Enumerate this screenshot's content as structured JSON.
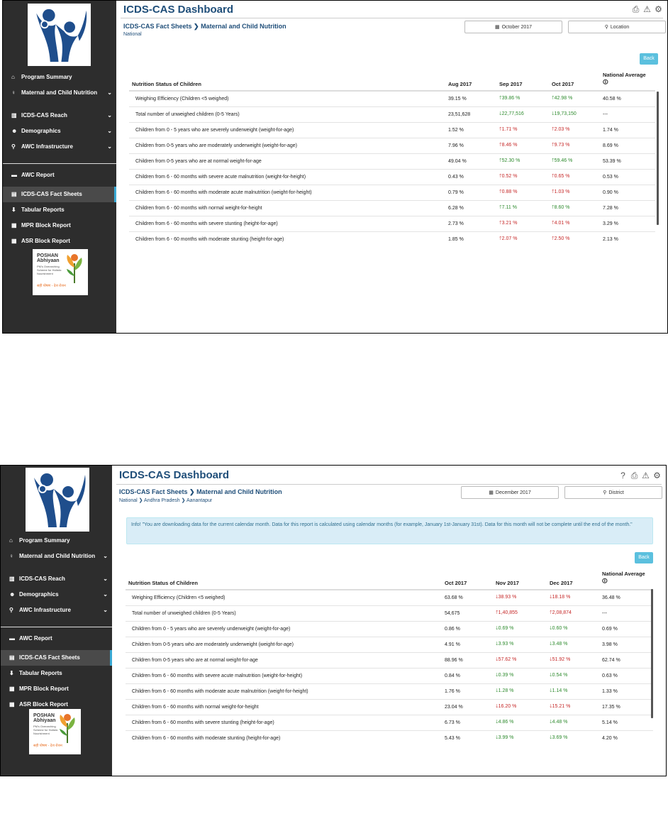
{
  "shots": [
    {
      "app_title": "ICDS-CAS Dashboard",
      "breadcrumb": "ICDS-CAS Fact Sheets ❯ Maternal and Child Nutrition",
      "location_path": "National",
      "month_picker": "October 2017",
      "location_picker": "Location",
      "back_label": "Back",
      "info_text": "",
      "top_icons": [
        "print-icon",
        "warning-icon",
        "gear-icon"
      ],
      "sidebar": {
        "group1": [
          {
            "icon": "home-icon",
            "label": "Program Summary",
            "chevron": false
          },
          {
            "icon": "maternal-icon",
            "label": "Maternal and Child Nutrition",
            "chevron": true
          },
          {
            "icon": "bar-chart-icon",
            "label": "ICDS-CAS Reach",
            "chevron": true
          },
          {
            "icon": "users-icon",
            "label": "Demographics",
            "chevron": true
          },
          {
            "icon": "map-marker-icon",
            "label": "AWC Infrastructure",
            "chevron": true
          }
        ],
        "group2": [
          {
            "icon": "report-icon",
            "label": "AWC Report",
            "active": false
          },
          {
            "icon": "file-icon",
            "label": "ICDS-CAS Fact Sheets",
            "active": true
          },
          {
            "icon": "download-icon",
            "label": "Tabular Reports",
            "active": false
          },
          {
            "icon": "grid-icon",
            "label": "MPR Block Report",
            "active": false
          },
          {
            "icon": "grid-icon",
            "label": "ASR Block Report",
            "active": false
          }
        ]
      },
      "poshan": {
        "title": "POSHAN Abhiyaan",
        "subtitle": "PM's Overarching Scheme for Holistic Nourishment",
        "hindi": "सही पोषण - देश रोशन"
      },
      "table": {
        "headers": [
          "Nutrition Status of Children",
          "Aug 2017",
          "Sep 2017",
          "Oct 2017",
          "National Average"
        ],
        "rows": [
          {
            "label": "Weighing Efficiency (Children <5 weighed)",
            "m1": "39.15 %",
            "m2": "39.86 %",
            "m2dir": "up-green",
            "m3": "42.98 %",
            "m3dir": "up-green",
            "avg": "40.58 %"
          },
          {
            "label": "Total number of unweighed children (0-5 Years)",
            "m1": "23,51,628",
            "m2": "22,77,516",
            "m2dir": "down-green",
            "m3": "19,73,150",
            "m3dir": "down-green",
            "avg": "---"
          },
          {
            "label": "Children from 0 - 5 years who are severely underweight (weight-for-age)",
            "m1": "1.52 %",
            "m2": "1.71 %",
            "m2dir": "up-red",
            "m3": "2.03 %",
            "m3dir": "up-red",
            "avg": "1.74 %"
          },
          {
            "label": "Children from 0-5 years who are moderately underweight (weight-for-age)",
            "m1": "7.96 %",
            "m2": "8.46 %",
            "m2dir": "up-red",
            "m3": "9.73 %",
            "m3dir": "up-red",
            "avg": "8.69 %"
          },
          {
            "label": "Children from 0-5 years who are at normal weight-for-age",
            "m1": "49.04 %",
            "m2": "52.30 %",
            "m2dir": "up-green",
            "m3": "59.46 %",
            "m3dir": "up-green",
            "avg": "53.39 %"
          },
          {
            "label": "Children from 6 - 60 months with severe acute malnutrition (weight-for-height)",
            "m1": "0.43 %",
            "m2": "0.52 %",
            "m2dir": "up-red",
            "m3": "0.65 %",
            "m3dir": "up-red",
            "avg": "0.53 %"
          },
          {
            "label": "Children from 6 - 60 months with moderate acute malnutrition (weight-for-height)",
            "m1": "0.79 %",
            "m2": "0.88 %",
            "m2dir": "up-red",
            "m3": "1.03 %",
            "m3dir": "up-red",
            "avg": "0.90 %"
          },
          {
            "label": "Children from 6 - 60 months with normal weight-for-height",
            "m1": "6.28 %",
            "m2": "7.11 %",
            "m2dir": "up-green",
            "m3": "8.60 %",
            "m3dir": "up-green",
            "avg": "7.28 %"
          },
          {
            "label": "Children from 6 - 60 months with severe stunting (height-for-age)",
            "m1": "2.73 %",
            "m2": "3.21 %",
            "m2dir": "up-red",
            "m3": "4.01 %",
            "m3dir": "up-red",
            "avg": "3.29 %"
          },
          {
            "label": "Children from 6 - 60 months with moderate stunting (height-for-age)",
            "m1": "1.85 %",
            "m2": "2.07 %",
            "m2dir": "up-red",
            "m3": "2.50 %",
            "m3dir": "up-red",
            "avg": "2.13 %"
          }
        ]
      }
    },
    {
      "app_title": "ICDS-CAS Dashboard",
      "breadcrumb": "ICDS-CAS Fact Sheets ❯ Maternal and Child Nutrition",
      "location_path": "National ❯ Andhra Pradesh ❯ Aanantapur",
      "month_picker": "December 2017",
      "location_picker": "District",
      "back_label": "Back",
      "info_text": "Info! \"You are downloading data for the current calendar month. Data for this report is calculated using calendar months (for example, January 1st-January 31st). Data for this month will not be complete until the end of the month.\"",
      "top_icons": [
        "help-icon",
        "print-icon",
        "warning-icon",
        "gear-icon"
      ],
      "sidebar": {
        "group1": [
          {
            "icon": "home-icon",
            "label": "Program Summary",
            "chevron": false
          },
          {
            "icon": "maternal-icon",
            "label": "Maternal and Child Nutrition",
            "chevron": true
          },
          {
            "icon": "bar-chart-icon",
            "label": "ICDS-CAS Reach",
            "chevron": true
          },
          {
            "icon": "users-icon",
            "label": "Demographics",
            "chevron": true
          },
          {
            "icon": "map-marker-icon",
            "label": "AWC Infrastructure",
            "chevron": true
          }
        ],
        "group2": [
          {
            "icon": "report-icon",
            "label": "AWC Report",
            "active": false
          },
          {
            "icon": "file-icon",
            "label": "ICDS-CAS Fact Sheets",
            "active": true
          },
          {
            "icon": "download-icon",
            "label": "Tabular Reports",
            "active": false
          },
          {
            "icon": "grid-icon",
            "label": "MPR Block Report",
            "active": false
          },
          {
            "icon": "grid-icon",
            "label": "ASR Block Report",
            "active": false
          }
        ]
      },
      "poshan": {
        "title": "POSHAN Abhiyaan",
        "subtitle": "PM's Overarching Scheme for Holistic Nourishment",
        "hindi": "सही पोषण - देश रोशन"
      },
      "table": {
        "headers": [
          "Nutrition Status of Children",
          "Oct 2017",
          "Nov 2017",
          "Dec 2017",
          "National Average"
        ],
        "rows": [
          {
            "label": "Weighing Efficiency (Children <5 weighed)",
            "m1": "63.68 %",
            "m2": "38.93 %",
            "m2dir": "down-red",
            "m3": "18.18 %",
            "m3dir": "down-red",
            "avg": "36.48 %"
          },
          {
            "label": "Total number of unweighed children (0-5 Years)",
            "m1": "54,675",
            "m2": "1,40,855",
            "m2dir": "up-red",
            "m3": "2,08,874",
            "m3dir": "up-red",
            "avg": "---"
          },
          {
            "label": "Children from 0 - 5 years who are severely underweight (weight-for-age)",
            "m1": "0.86 %",
            "m2": "0.69 %",
            "m2dir": "down-green",
            "m3": "0.60 %",
            "m3dir": "down-green",
            "avg": "0.69 %"
          },
          {
            "label": "Children from 0-5 years who are moderately underweight (weight-for-age)",
            "m1": "4.91 %",
            "m2": "3.93 %",
            "m2dir": "down-green",
            "m3": "3.48 %",
            "m3dir": "down-green",
            "avg": "3.98 %"
          },
          {
            "label": "Children from 0-5 years who are at normal weight-for-age",
            "m1": "88.96 %",
            "m2": "57.62 %",
            "m2dir": "down-red",
            "m3": "51.92 %",
            "m3dir": "down-red",
            "avg": "62.74 %"
          },
          {
            "label": "Children from 6 - 60 months with severe acute malnutrition (weight-for-height)",
            "m1": "0.84 %",
            "m2": "0.39 %",
            "m2dir": "down-green",
            "m3": "0.54 %",
            "m3dir": "down-green",
            "avg": "0.63 %"
          },
          {
            "label": "Children from 6 - 60 months with moderate acute malnutrition (weight-for-height)",
            "m1": "1.76 %",
            "m2": "1.28 %",
            "m2dir": "down-green",
            "m3": "1.14 %",
            "m3dir": "down-green",
            "avg": "1.33 %"
          },
          {
            "label": "Children from 6 - 60 months with normal weight-for-height",
            "m1": "23.04 %",
            "m2": "16.20 %",
            "m2dir": "down-red",
            "m3": "15.21 %",
            "m3dir": "down-red",
            "avg": "17.35 %"
          },
          {
            "label": "Children from 6 - 60 months with severe stunting (height-for-age)",
            "m1": "6.73 %",
            "m2": "4.86 %",
            "m2dir": "down-green",
            "m3": "4.48 %",
            "m3dir": "down-green",
            "avg": "5.14 %"
          },
          {
            "label": "Children from 6 - 60 months with moderate stunting (height-for-age)",
            "m1": "5.43 %",
            "m2": "3.99 %",
            "m2dir": "down-green",
            "m3": "3.69 %",
            "m3dir": "down-green",
            "avg": "4.20 %"
          }
        ]
      }
    }
  ]
}
